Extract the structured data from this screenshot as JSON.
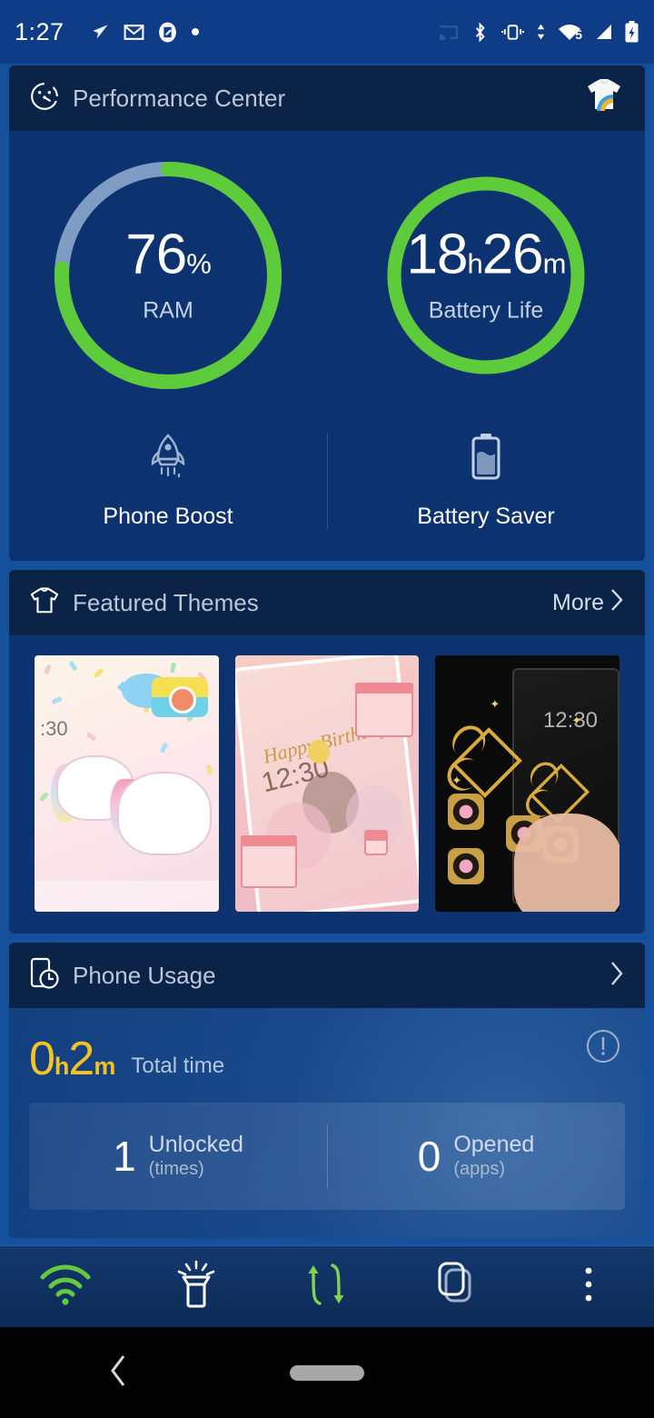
{
  "status_bar": {
    "time": "1:27",
    "left_icons": [
      "send-icon",
      "gmail-icon",
      "screenshot-icon",
      "dot-icon"
    ],
    "right_icons": [
      "cast-icon",
      "bluetooth-icon",
      "vibrate-icon",
      "data-transfer-icon",
      "wifi-icon",
      "signal-icon",
      "battery-charging-icon"
    ],
    "wifi_badge": "5",
    "background": "#0e3c87"
  },
  "performance": {
    "header": {
      "icon": "speedometer-icon",
      "title": "Performance Center",
      "right_icon": "tshirt-icon"
    },
    "ram": {
      "value": "76",
      "unit": "%",
      "label": "RAM",
      "percent": 76,
      "ring_color": "#5ecb3a",
      "track_color": "#7f9dc4"
    },
    "battery": {
      "value_hours": "18",
      "unit_h": "h",
      "value_minutes": "26",
      "unit_m": "m",
      "label": "Battery Life",
      "percent": 100,
      "ring_color": "#5ecb3a"
    },
    "actions": [
      {
        "icon": "rocket-icon",
        "label": "Phone Boost"
      },
      {
        "icon": "battery-icon",
        "label": "Battery Saver"
      }
    ]
  },
  "themes": {
    "header": {
      "icon": "tshirt-outline-icon",
      "title": "Featured Themes",
      "more_label": "More",
      "more_icon": "chevron-right-icon"
    },
    "items": [
      {
        "name": "unicorn-theme",
        "caption_time": ":30",
        "accent": "#f7c6dc"
      },
      {
        "name": "happy-birthday-theme",
        "caption_title": "Happy Birthday",
        "caption_time": "12:30",
        "accent": "#ef8a93"
      },
      {
        "name": "gold-heart-theme",
        "caption_time": "12:30",
        "accent": "#d9ab3d"
      }
    ]
  },
  "phone_usage": {
    "header": {
      "icon": "phone-clock-icon",
      "title": "Phone Usage",
      "chevron": "chevron-right-icon"
    },
    "total": {
      "hours": "0",
      "unit_h": "h",
      "minutes": "2",
      "unit_m": "m",
      "label": "Total time",
      "color": "#f5c124"
    },
    "info_icon": "info-icon",
    "stats": [
      {
        "value": "1",
        "label": "Unlocked",
        "sublabel": "(times)"
      },
      {
        "value": "0",
        "label": "Opened",
        "sublabel": "(apps)"
      }
    ]
  },
  "toolbar": {
    "items": [
      {
        "icon": "wifi-icon",
        "color": "#63c93f"
      },
      {
        "icon": "flashlight-icon",
        "color": "#ffffff"
      },
      {
        "icon": "data-sync-icon",
        "color": "#63c93f"
      },
      {
        "icon": "clone-icon",
        "color": "#ffffff"
      },
      {
        "icon": "overflow-menu-icon",
        "color": "#ffffff"
      }
    ]
  },
  "navbar": {
    "back_icon": "back-chevron-icon",
    "home_pill": "home-pill"
  }
}
